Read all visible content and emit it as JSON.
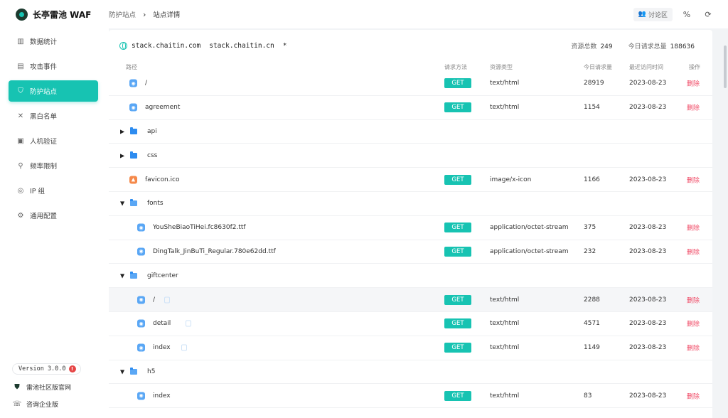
{
  "app": {
    "name": "长亭雷池 WAF"
  },
  "breadcrumb": {
    "parent": "防护站点",
    "sep": "›",
    "current": "站点详情"
  },
  "topbar": {
    "forum_label": "讨论区",
    "forum_icon": "users-icon",
    "switch_icon": "percent-icon",
    "logout_icon": "logout-icon"
  },
  "sidebar": {
    "items": [
      {
        "label": "数据统计",
        "icon": "bar-chart-icon",
        "glyph": "▥",
        "active": false
      },
      {
        "label": "攻击事件",
        "icon": "document-icon",
        "glyph": "▤",
        "active": false
      },
      {
        "label": "防护站点",
        "icon": "shield-icon",
        "glyph": "⛉",
        "active": true
      },
      {
        "label": "黑白名单",
        "icon": "tools-icon",
        "glyph": "✕",
        "active": false
      },
      {
        "label": "人机验证",
        "icon": "captcha-icon",
        "glyph": "▣",
        "active": false
      },
      {
        "label": "频率限制",
        "icon": "gauge-icon",
        "glyph": "⚲",
        "active": false
      },
      {
        "label": "IP 组",
        "icon": "location-icon",
        "glyph": "◎",
        "active": false
      },
      {
        "label": "通用配置",
        "icon": "gear-icon",
        "glyph": "⚙",
        "active": false
      }
    ],
    "version": "Version 3.0.0",
    "version_badge": "!",
    "community_link": "雷池社区版官网",
    "enterprise_link": "咨询企业版"
  },
  "site": {
    "domains": [
      "stack.chaitin.com",
      "stack.chaitin.cn",
      "*"
    ],
    "resource_total_label": "资源总数",
    "resource_total": "249",
    "today_requests_label": "今日请求总量",
    "today_requests": "188636"
  },
  "table": {
    "headers": {
      "path": "路径",
      "method": "请求方法",
      "type": "资源类型",
      "today": "今日请求量",
      "last": "最近访问时间",
      "action": "操作"
    },
    "delete_label": "删除",
    "rows": [
      {
        "kind": "file",
        "level": 0,
        "name": "/",
        "method": "GET",
        "type": "text/html",
        "count": "28919",
        "date": "2023-08-23"
      },
      {
        "kind": "file",
        "level": 0,
        "name": "agreement",
        "method": "GET",
        "type": "text/html",
        "count": "1154",
        "date": "2023-08-23"
      },
      {
        "kind": "folder",
        "level": 0,
        "open": false,
        "name": "api"
      },
      {
        "kind": "folder",
        "level": 0,
        "open": false,
        "name": "css"
      },
      {
        "kind": "image",
        "level": 0,
        "name": "favicon.ico",
        "method": "GET",
        "type": "image/x-icon",
        "count": "1166",
        "date": "2023-08-23"
      },
      {
        "kind": "folder",
        "level": 0,
        "open": true,
        "name": "fonts"
      },
      {
        "kind": "file",
        "level": 1,
        "name": "YouSheBiaoTiHei.fc8630f2.ttf",
        "method": "GET",
        "type": "application/octet-stream",
        "count": "375",
        "date": "2023-08-23"
      },
      {
        "kind": "file",
        "level": 1,
        "name": "DingTalk_JinBuTi_Regular.780e62dd.ttf",
        "method": "GET",
        "type": "application/octet-stream",
        "count": "232",
        "date": "2023-08-23"
      },
      {
        "kind": "folder",
        "level": 0,
        "open": true,
        "name": "giftcenter"
      },
      {
        "kind": "file",
        "level": 1,
        "name": "/",
        "copy": true,
        "highlight": true,
        "method": "GET",
        "type": "text/html",
        "count": "2288",
        "date": "2023-08-23"
      },
      {
        "kind": "file",
        "level": 1,
        "name": "detail",
        "copy": true,
        "method": "GET",
        "type": "text/html",
        "count": "4571",
        "date": "2023-08-23"
      },
      {
        "kind": "file",
        "level": 1,
        "name": "index",
        "copy": true,
        "method": "GET",
        "type": "text/html",
        "count": "1149",
        "date": "2023-08-23"
      },
      {
        "kind": "folder",
        "level": 0,
        "open": true,
        "name": "h5"
      },
      {
        "kind": "file",
        "level": 1,
        "name": "index",
        "method": "GET",
        "type": "text/html",
        "count": "83",
        "date": "2023-08-23"
      }
    ]
  }
}
